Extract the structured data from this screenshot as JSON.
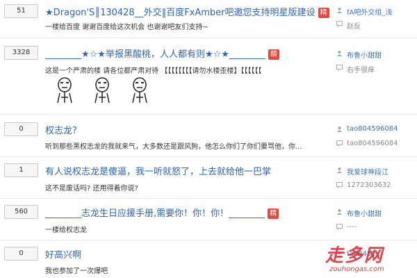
{
  "threads": [
    {
      "count": "51",
      "title": "★Dragon'S║130428__外交‖百度FxAmber吧邀您支持明星版建设",
      "badge": "精",
      "summary": "一楼给百度 谢谢百度给这次机会 也谢谢吧友们支持~",
      "author": "fA吧外交组_浅",
      "replier": "赵反"
    },
    {
      "count": "3328",
      "title": "________★☆★举报黑酸桃，人人都有则★☆★________",
      "badge": "精",
      "summary": "这是一个严肃的楼 请各位都严肃对待 【【【【【【【【请勿水楼歪楼】【【【【【【",
      "author": "布鲁小甜甜",
      "replier": "右手很痒"
    },
    {
      "count": "0",
      "title": "权志龙?",
      "summary": "听到那些黑权志龙的我就来气，大多数还是跟风狗，他怎么你们了你们要骂他，你...",
      "author": "tao804596084",
      "replier": "tao804596084"
    },
    {
      "count": "1",
      "title": "有人说权志龙是傻逼，我一听就怒了，上去就给他一巴掌",
      "summary": "这不是废话吗? 还用得着你说?",
      "author": "我爱球神段江",
      "replier": "1272303632"
    },
    {
      "count": "560",
      "title": "________志龙生日应援手册,需要你！你！你！________",
      "badge": "精",
      "summary": "一楼给权志龙",
      "author": "布鲁小甜甜",
      "replier": "----"
    },
    {
      "count": "0",
      "title": "好高兴啊",
      "summary": "我也参加了一次爆吧",
      "author": "tao8431..",
      "replier": ""
    }
  ],
  "watermark": {
    "brand": "走多网",
    "url": "zouhongas.com"
  },
  "colors": {
    "title": "#2d64b3",
    "badge": "#e8473f",
    "author": "#3b73b9",
    "watermark": "#d9242b"
  }
}
